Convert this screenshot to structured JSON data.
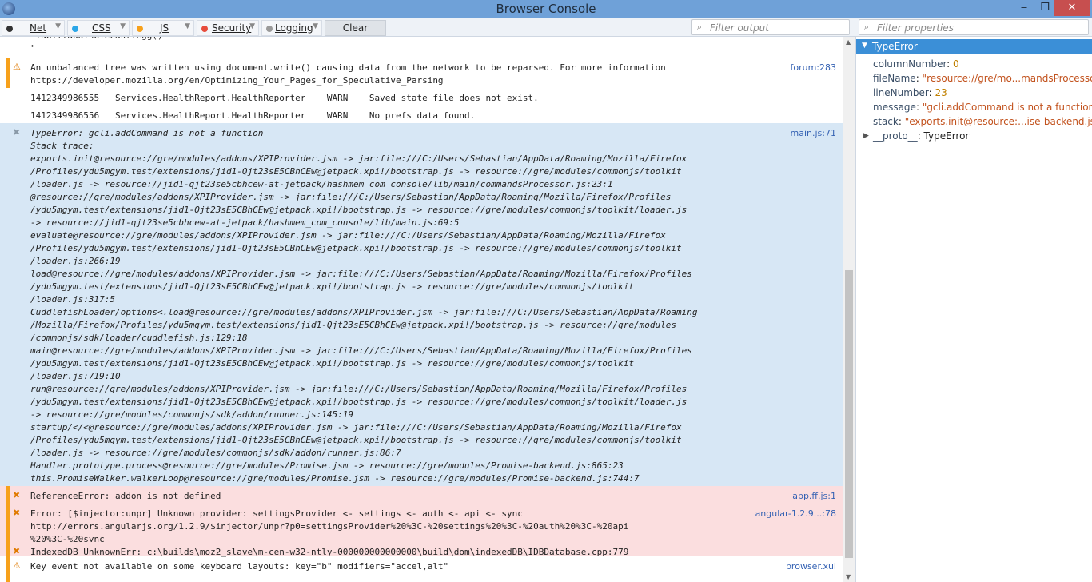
{
  "window": {
    "title": "Browser Console",
    "minimize": "‒",
    "maximize": "❐",
    "close": "✕"
  },
  "toolbar": {
    "filters": [
      {
        "label": "Net",
        "dot": "#333333"
      },
      {
        "label": "CSS",
        "dot": "#2aa6e8"
      },
      {
        "label": "JS",
        "dot": "#f7a11b"
      },
      {
        "label": "Security",
        "dot": "#e74c3c"
      },
      {
        "label": "Logging",
        "dot": "#9a9a9a"
      }
    ],
    "clear_label": "Clear",
    "filter_output_placeholder": "Filter output",
    "filter_properties_placeholder": "Filter properties"
  },
  "rows": [
    {
      "kind": "plain",
      "lines": [
        " fabiffaudisbiecast:egg()",
        "\""
      ],
      "location": ""
    },
    {
      "kind": "warn",
      "lines": [
        "An unbalanced tree was written using document.write() causing data from the network to be reparsed. For more information",
        "https://developer.mozilla.org/en/Optimizing_Your_Pages_for_Speculative_Parsing"
      ],
      "location": "forum:283"
    },
    {
      "kind": "plain",
      "lines": [
        "1412349986555   Services.HealthReport.HealthReporter    WARN    Saved state file does not exist."
      ],
      "location": ""
    },
    {
      "kind": "plain",
      "lines": [
        "1412349986556   Services.HealthReport.HealthReporter    WARN    No prefs data found."
      ],
      "location": ""
    },
    {
      "kind": "exc",
      "lines": [
        "TypeError: gcli.addCommand is not a function",
        "Stack trace:",
        "exports.init@resource://gre/modules/addons/XPIProvider.jsm -> jar:file:///C:/Users/Sebastian/AppData/Roaming/Mozilla/Firefox",
        "/Profiles/ydu5mgym.test/extensions/jid1-Qjt23sE5CBhCEw@jetpack.xpi!/bootstrap.js -> resource://gre/modules/commonjs/toolkit",
        "/loader.js -> resource://jid1-qjt23se5cbhcew-at-jetpack/hashmem_com_console/lib/main/commandsProcessor.js:23:1",
        "@resource://gre/modules/addons/XPIProvider.jsm -> jar:file:///C:/Users/Sebastian/AppData/Roaming/Mozilla/Firefox/Profiles",
        "/ydu5mgym.test/extensions/jid1-Qjt23sE5CBhCEw@jetpack.xpi!/bootstrap.js -> resource://gre/modules/commonjs/toolkit/loader.js",
        "-> resource://jid1-qjt23se5cbhcew-at-jetpack/hashmem_com_console/lib/main.js:69:5",
        "evaluate@resource://gre/modules/addons/XPIProvider.jsm -> jar:file:///C:/Users/Sebastian/AppData/Roaming/Mozilla/Firefox",
        "/Profiles/ydu5mgym.test/extensions/jid1-Qjt23sE5CBhCEw@jetpack.xpi!/bootstrap.js -> resource://gre/modules/commonjs/toolkit",
        "/loader.js:266:19",
        "load@resource://gre/modules/addons/XPIProvider.jsm -> jar:file:///C:/Users/Sebastian/AppData/Roaming/Mozilla/Firefox/Profiles",
        "/ydu5mgym.test/extensions/jid1-Qjt23sE5CBhCEw@jetpack.xpi!/bootstrap.js -> resource://gre/modules/commonjs/toolkit",
        "/loader.js:317:5",
        "CuddlefishLoader/options<.load@resource://gre/modules/addons/XPIProvider.jsm -> jar:file:///C:/Users/Sebastian/AppData/Roaming",
        "/Mozilla/Firefox/Profiles/ydu5mgym.test/extensions/jid1-Qjt23sE5CBhCEw@jetpack.xpi!/bootstrap.js -> resource://gre/modules",
        "/commonjs/sdk/loader/cuddlefish.js:129:18",
        "main@resource://gre/modules/addons/XPIProvider.jsm -> jar:file:///C:/Users/Sebastian/AppData/Roaming/Mozilla/Firefox/Profiles",
        "/ydu5mgym.test/extensions/jid1-Qjt23sE5CBhCEw@jetpack.xpi!/bootstrap.js -> resource://gre/modules/commonjs/toolkit",
        "/loader.js:719:10",
        "run@resource://gre/modules/addons/XPIProvider.jsm -> jar:file:///C:/Users/Sebastian/AppData/Roaming/Mozilla/Firefox/Profiles",
        "/ydu5mgym.test/extensions/jid1-Qjt23sE5CBhCEw@jetpack.xpi!/bootstrap.js -> resource://gre/modules/commonjs/toolkit/loader.js",
        "-> resource://gre/modules/commonjs/sdk/addon/runner.js:145:19",
        "startup/</<@resource://gre/modules/addons/XPIProvider.jsm -> jar:file:///C:/Users/Sebastian/AppData/Roaming/Mozilla/Firefox",
        "/Profiles/ydu5mgym.test/extensions/jid1-Qjt23sE5CBhCEw@jetpack.xpi!/bootstrap.js -> resource://gre/modules/commonjs/toolkit",
        "/loader.js -> resource://gre/modules/commonjs/sdk/addon/runner.js:86:7",
        "Handler.prototype.process@resource://gre/modules/Promise.jsm -> resource://gre/modules/Promise-backend.js:865:23",
        "this.PromiseWalker.walkerLoop@resource://gre/modules/Promise.jsm -> resource://gre/modules/Promise-backend.js:744:7"
      ],
      "location": "main.js:71"
    },
    {
      "kind": "error",
      "lines": [
        "ReferenceError: addon is not defined"
      ],
      "location": "app.ff.js:1"
    },
    {
      "kind": "error",
      "lines": [
        "Error: [$injector:unpr] Unknown provider: settingsProvider <- settings <- auth <- api <- sync",
        "http://errors.angularjs.org/1.2.9/$injector/unpr?p0=settingsProvider%20%3C-%20settings%20%3C-%20auth%20%3C-%20api",
        "%20%3C-%20sync"
      ],
      "location": "angular-1.2.9...:78"
    },
    {
      "kind": "error",
      "lines": [
        "IndexedDB UnknownErr: c:\\builds\\moz2_slave\\m-cen-w32-ntly-000000000000000\\build\\dom\\indexedDB\\IDBDatabase.cpp:779"
      ],
      "location": ""
    },
    {
      "kind": "warn",
      "lines": [
        "Key event not available on some keyboard layouts: key=\"b\" modifiers=\"accel,alt\""
      ],
      "location": "browser.xul"
    }
  ],
  "panel": {
    "header": "TypeError",
    "properties": [
      {
        "key": "columnNumber",
        "value": "0",
        "type": "num"
      },
      {
        "key": "fileName",
        "value": "\"resource://gre/mo...mandsProcessor.js\"",
        "type": "str"
      },
      {
        "key": "lineNumber",
        "value": "23",
        "type": "num"
      },
      {
        "key": "message",
        "value": "\"gcli.addCommand is not a function\"",
        "type": "str"
      },
      {
        "key": "stack",
        "value": "\"exports.init@resource:...ise-backend.js:744:7\"",
        "type": "str"
      }
    ],
    "proto_key": "__proto__",
    "proto_value": "TypeError"
  },
  "icons": {
    "warn": "⚠",
    "error": "✖",
    "exc": "✖",
    "search": "⌕"
  }
}
